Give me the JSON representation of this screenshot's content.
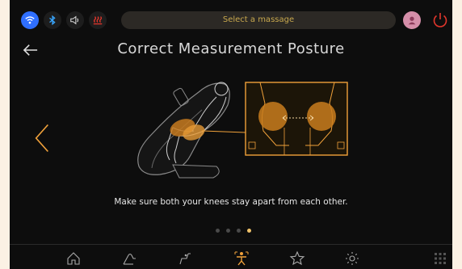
{
  "header": {
    "program_pill": "Select a massage"
  },
  "page": {
    "title": "Correct Measurement Posture",
    "instruction": "Make sure both your knees stay apart from each other."
  },
  "pagination": {
    "total": 4,
    "active_index": 3
  },
  "status_icons": [
    "wifi-icon",
    "bluetooth-icon",
    "volume-icon",
    "heat-icon"
  ],
  "bottom_nav": [
    "home-icon",
    "manual-mode-icon",
    "auto-program-icon",
    "body-scan-icon",
    "favorites-icon",
    "settings-icon",
    "app-grid-icon"
  ],
  "colors": {
    "accent": "#f0a13a",
    "status_blue": "#2f6fff",
    "power_red": "#e2362c",
    "pill_text": "#c8a84e"
  }
}
